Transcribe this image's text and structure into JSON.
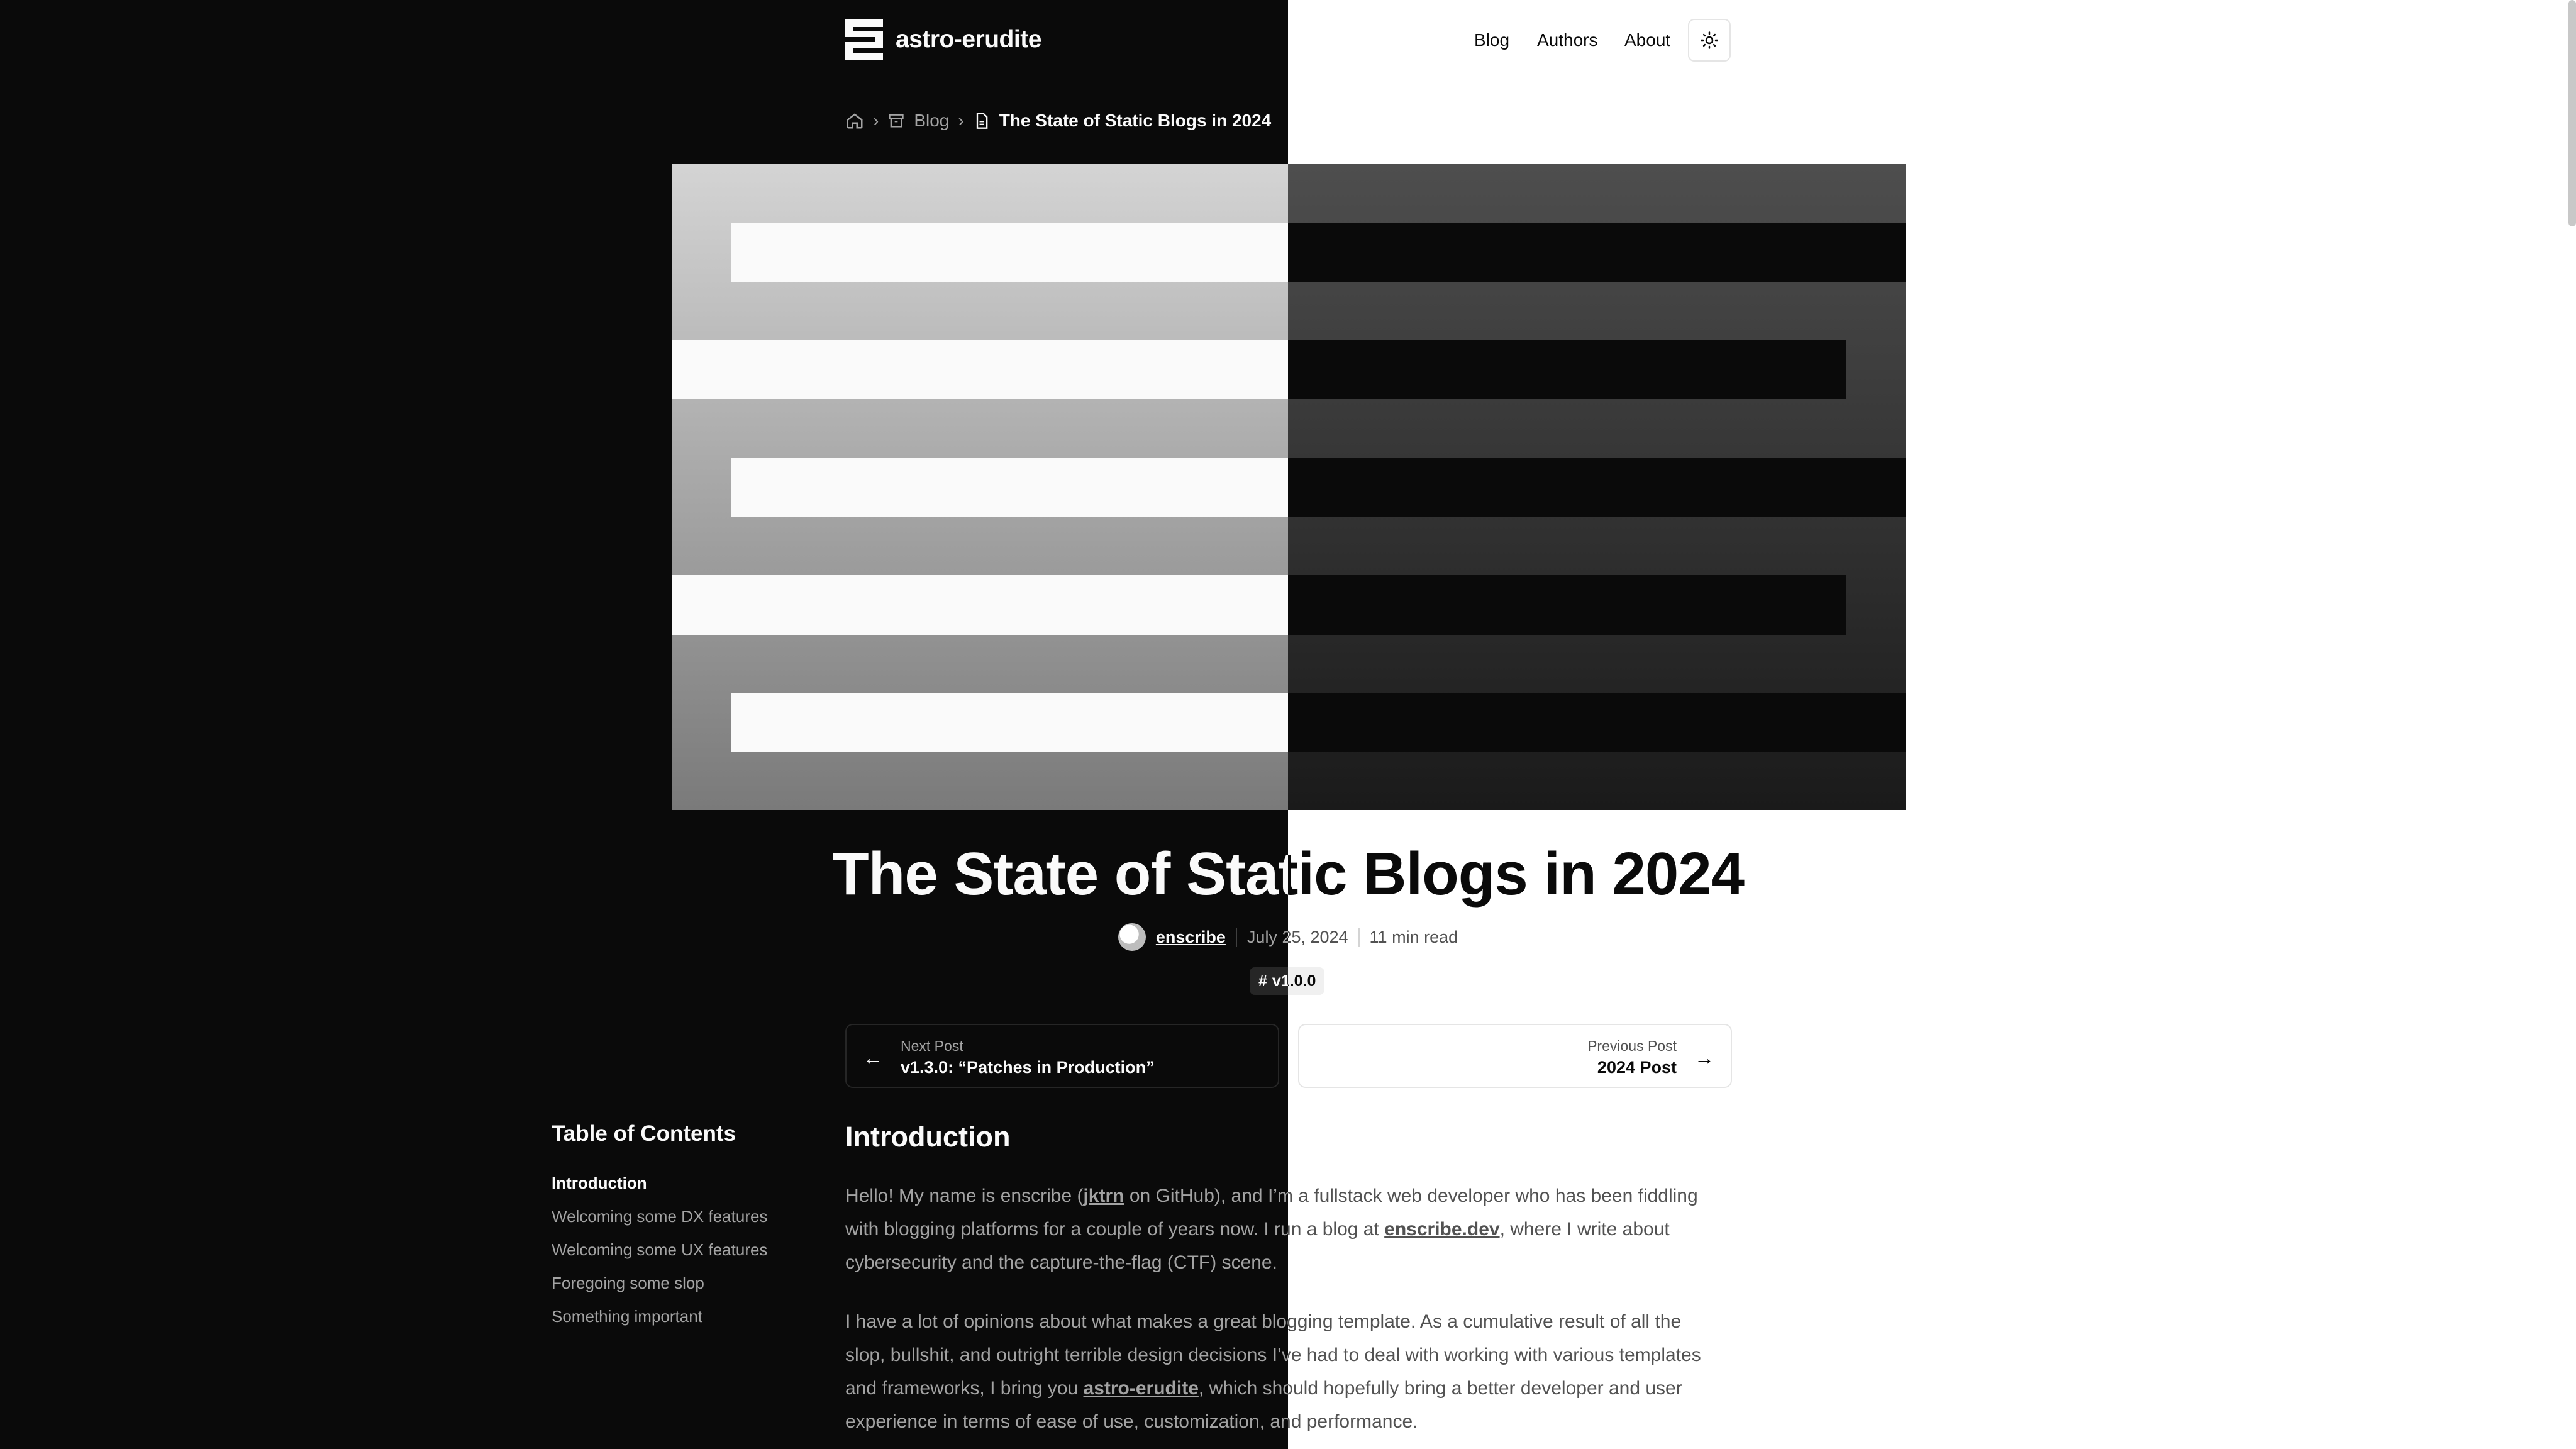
{
  "site": {
    "name": "astro-erudite"
  },
  "nav": {
    "blog": "Blog",
    "authors": "Authors",
    "about": "About"
  },
  "breadcrumb": {
    "blog": "Blog",
    "current": "The State of Static Blogs in 2024"
  },
  "post": {
    "title": "The State of Static Blogs in 2024",
    "author": "enscribe",
    "date": "July 25, 2024",
    "read_time": "11 min read",
    "tag": "v1.0.0"
  },
  "post_nav": {
    "next_label": "Next Post",
    "next_title": "v1.3.0: “Patches in Production”",
    "prev_label": "Previous Post",
    "prev_title": "2024 Post"
  },
  "toc": {
    "title": "Table of Contents",
    "items": [
      "Introduction",
      "Welcoming some DX features",
      "Welcoming some UX features",
      "Foregoing some slop",
      "Something important"
    ]
  },
  "article": {
    "heading": "Introduction",
    "p1": {
      "t1": "Hello! My name is enscribe (",
      "link1": "jktrn",
      "t2": " on GitHub), and I’m a fullstack web developer who has been fiddling",
      "t3": "with blogging platforms for a couple of years now. I run a blog at ",
      "link2": "enscribe.dev",
      "t4": ", where I write about",
      "t5": "cybersecurity and the capture-the-flag (CTF) scene."
    },
    "p2": {
      "l1": "I have a lot of opinions about what makes a great blogging template. As a cumulative result of all the",
      "l2": "slop, bullshit, and outright terrible design decisions I’ve had to deal with working with various templates",
      "l3a": "and frameworks, I bring you ",
      "link": "astro-erudite",
      "l3b": ", which should hopefully bring a better developer and user",
      "l4": "experience in terms of ease of use, customization, and performance."
    }
  }
}
